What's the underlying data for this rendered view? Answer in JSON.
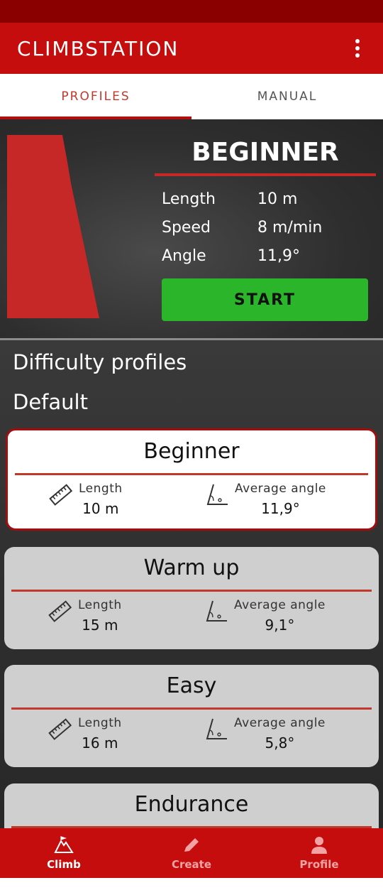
{
  "app": {
    "title": "CLIMBSTATION"
  },
  "tabs": [
    {
      "label": "PROFILES",
      "active": true
    },
    {
      "label": "MANUAL",
      "active": false
    }
  ],
  "hero": {
    "title": "BEGINNER",
    "stats": [
      {
        "label": "Length",
        "value": "10 m"
      },
      {
        "label": "Speed",
        "value": "8 m/min"
      },
      {
        "label": "Angle",
        "value": "11,9°"
      }
    ],
    "start_label": "START"
  },
  "list": {
    "section_title": "Difficulty profiles",
    "group_title": "Default",
    "cards": [
      {
        "title": "Beginner",
        "length_label": "Length",
        "length": "10 m",
        "angle_label": "Average angle",
        "angle": "11,9°",
        "selected": true
      },
      {
        "title": "Warm up",
        "length_label": "Length",
        "length": "15 m",
        "angle_label": "Average angle",
        "angle": "9,1°",
        "selected": false
      },
      {
        "title": "Easy",
        "length_label": "Length",
        "length": "16 m",
        "angle_label": "Average angle",
        "angle": "5,8°",
        "selected": false
      },
      {
        "title": "Endurance",
        "selected": false
      }
    ]
  },
  "bottom_nav": [
    {
      "label": "Climb",
      "icon": "climb-icon",
      "active": true
    },
    {
      "label": "Create",
      "icon": "pencil-icon",
      "active": false
    },
    {
      "label": "Profile",
      "icon": "person-icon",
      "active": false
    }
  ],
  "colors": {
    "brand_red": "#c50d0d",
    "start_green": "#2bb52b",
    "status_red": "#8a0000"
  }
}
